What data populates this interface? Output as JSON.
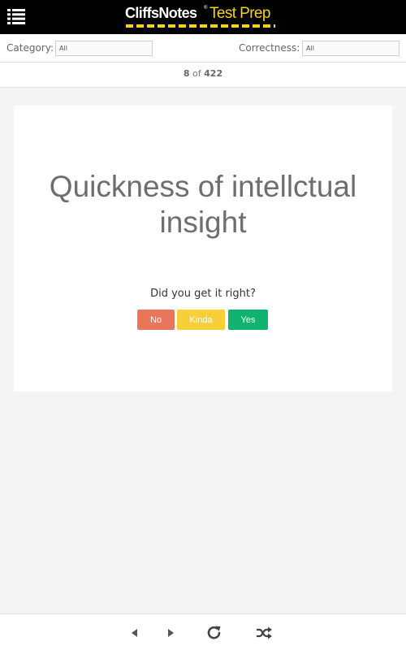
{
  "header": {
    "logo_brand": "CliffsNotes",
    "logo_reg": "®",
    "logo_product": "Test Prep",
    "menu_icon": "hamburger-list-icon"
  },
  "filters": {
    "category_label": "Category:",
    "category_value": "All",
    "correctness_label": "Correctness:",
    "correctness_value": "All"
  },
  "counter": {
    "current": "8",
    "separator": "of",
    "total": "422"
  },
  "card": {
    "text": "Quickness of intellctual insight",
    "prompt": "Did you get it right?",
    "buttons": {
      "no": "No",
      "kinda": "Kinda",
      "yes": "Yes"
    }
  },
  "bottom_nav": {
    "icons": [
      "previous-icon",
      "next-icon",
      "reload-icon",
      "shuffle-icon"
    ]
  },
  "colors": {
    "header_bg": "#000000",
    "brand_yellow": "#f5d21e",
    "no": "#e9765a",
    "kinda": "#f7cf37",
    "yes": "#0db36e"
  }
}
